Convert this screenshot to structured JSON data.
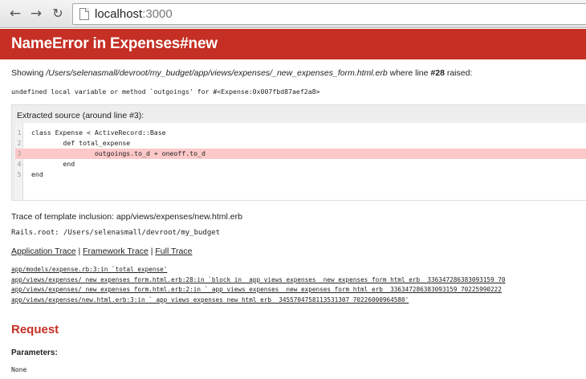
{
  "browser": {
    "url_host": "localhost",
    "url_port": ":3000",
    "icons": {
      "back": "arrow-left-icon",
      "forward": "arrow-right-icon",
      "reload": "reload-icon",
      "page": "page-icon"
    }
  },
  "error": {
    "title": "NameError in Expenses#new",
    "showing_prefix": "Showing ",
    "showing_path": "/Users/selenasmall/devroot/my_budget/app/views/expenses/_new_expenses_form.html.erb",
    "showing_mid": " where line ",
    "showing_line": "#28",
    "showing_suffix": " raised:",
    "message": "undefined local variable or method `outgoings' for #<Expense:0x007fbd87aef2a8>"
  },
  "source": {
    "title": "Extracted source (around line #3):",
    "lines": [
      {
        "num": "1",
        "text": "class Expense < ActiveRecord::Base"
      },
      {
        "num": "2",
        "text": "        def total_expense"
      },
      {
        "num": "3",
        "text": "                outgoings.to_d + oneoff.to_d"
      },
      {
        "num": "4",
        "text": "        end"
      },
      {
        "num": "5",
        "text": "end"
      }
    ],
    "highlight_color": "#fcc8c8"
  },
  "trace_inclusion": "Trace of template inclusion: app/views/expenses/new.html.erb",
  "rails_root": "Rails.root: /Users/selenasmall/devroot/my_budget",
  "trace_tabs": {
    "application": "Application Trace",
    "sep1": " | ",
    "framework": "Framework Trace",
    "sep2": " | ",
    "full": "Full Trace"
  },
  "trace_lines": [
    "app/models/expense.rb:3:in `total_expense'",
    "app/views/expenses/_new_expenses_form.html.erb:28:in `block in _app_views_expenses__new_expenses_form_html_erb__3363472863830931​59_70",
    "app/views/expenses/_new_expenses_form.html.erb:2:in `_app_views_expenses__new_expenses_form_html_erb__336347286383093159_70225990222",
    "app/views/expenses/new.html.erb:3:in `_app_views_expenses_new_html_erb__3455704758113531307_70226000964580'"
  ],
  "request": {
    "heading": "Request",
    "params_label": "Parameters:",
    "params_value": "None"
  },
  "colors": {
    "header_red": "#c52f24"
  }
}
